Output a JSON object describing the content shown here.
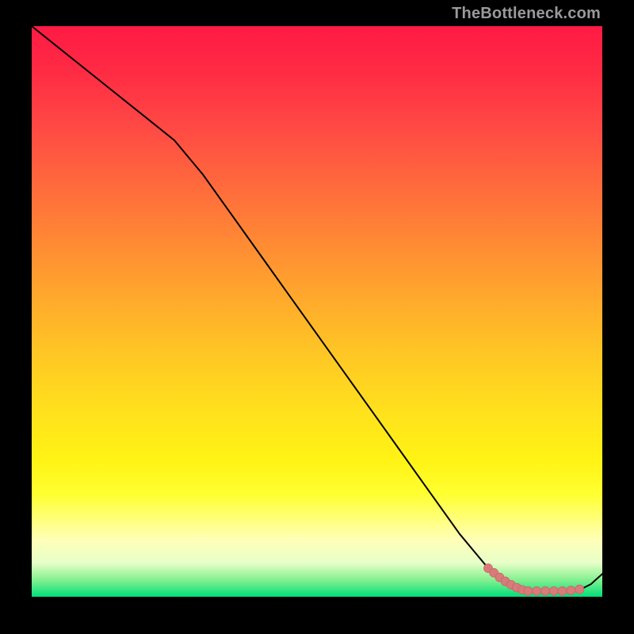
{
  "watermark": {
    "text": "TheBottleneck.com"
  },
  "colors": {
    "line": "#000000",
    "marker_fill": "#d97b7b",
    "marker_stroke": "#c96565"
  },
  "chart_data": {
    "type": "line",
    "title": "",
    "xlabel": "",
    "ylabel": "",
    "xlim": [
      0,
      100
    ],
    "ylim": [
      0,
      100
    ],
    "grid": false,
    "legend": false,
    "series": [
      {
        "name": "bottleneck-curve",
        "x": [
          0,
          5,
          10,
          15,
          20,
          25,
          30,
          35,
          40,
          45,
          50,
          55,
          60,
          65,
          70,
          75,
          80,
          82,
          84,
          86,
          88,
          90,
          92,
          94,
          96,
          98,
          100
        ],
        "y": [
          100,
          96,
          92,
          88,
          84,
          80,
          74,
          67,
          60,
          53,
          46,
          39,
          32,
          25,
          18,
          11,
          5,
          3,
          1.5,
          1,
          1,
          1,
          1,
          1,
          1.2,
          2.2,
          4
        ]
      }
    ],
    "markers": [
      {
        "x": 80.0,
        "y": 5.0
      },
      {
        "x": 81.0,
        "y": 4.2
      },
      {
        "x": 82.0,
        "y": 3.4
      },
      {
        "x": 83.0,
        "y": 2.7
      },
      {
        "x": 84.0,
        "y": 2.1
      },
      {
        "x": 85.0,
        "y": 1.6
      },
      {
        "x": 86.0,
        "y": 1.2
      },
      {
        "x": 87.0,
        "y": 1.0
      },
      {
        "x": 88.5,
        "y": 1.0
      },
      {
        "x": 90.0,
        "y": 1.0
      },
      {
        "x": 91.5,
        "y": 1.0
      },
      {
        "x": 93.0,
        "y": 1.0
      },
      {
        "x": 94.5,
        "y": 1.1
      },
      {
        "x": 96.0,
        "y": 1.3
      }
    ]
  }
}
